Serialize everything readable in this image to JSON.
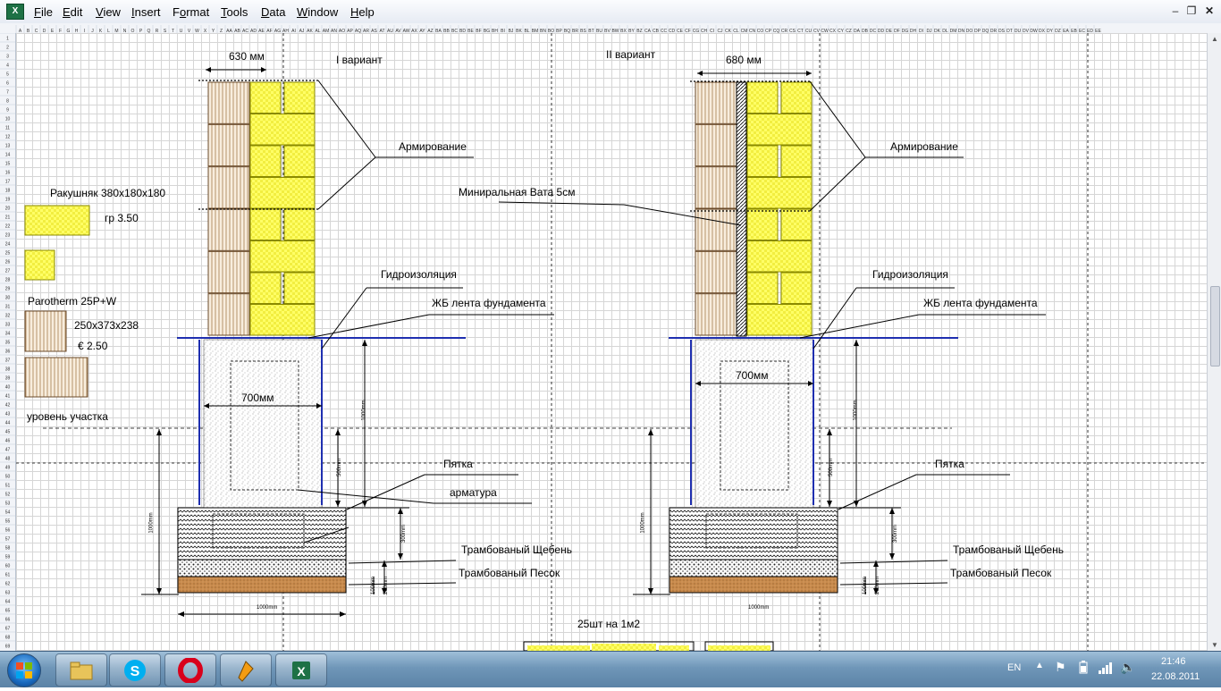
{
  "window": {
    "app_icon": "excel-icon",
    "menus": [
      {
        "label": "File",
        "accel": "F"
      },
      {
        "label": "Edit",
        "accel": "E"
      },
      {
        "label": "View",
        "accel": "V"
      },
      {
        "label": "Insert",
        "accel": "I"
      },
      {
        "label": "Format",
        "accel": "o"
      },
      {
        "label": "Tools",
        "accel": "T"
      },
      {
        "label": "Data",
        "accel": "D"
      },
      {
        "label": "Window",
        "accel": "W"
      },
      {
        "label": "Help",
        "accel": "H"
      }
    ],
    "controls": [
      "minimize-icon",
      "restore-icon",
      "close-icon"
    ]
  },
  "sheet": {
    "column_headers": [
      "A",
      "B",
      "C",
      "D",
      "E",
      "F",
      "G",
      "H",
      "I",
      "J",
      "K",
      "L",
      "M",
      "N",
      "O",
      "P",
      "Q",
      "R",
      "S",
      "T",
      "U",
      "V",
      "W",
      "X",
      "Y",
      "Z",
      "AA",
      "AB",
      "AC",
      "AD",
      "AE",
      "AF",
      "AG",
      "AH",
      "AI",
      "AJ",
      "AK",
      "AL",
      "AM",
      "AN",
      "AO",
      "AP",
      "AQ",
      "AR",
      "AS",
      "AT",
      "AU",
      "AV",
      "AW",
      "AX",
      "AY",
      "AZ",
      "BA",
      "BB",
      "BC",
      "BD",
      "BE",
      "BF",
      "BG",
      "BH",
      "BI",
      "BJ",
      "BK",
      "BL",
      "BM",
      "BN",
      "BO",
      "BP",
      "BQ",
      "BR",
      "BS",
      "BT",
      "BU",
      "BV",
      "BW",
      "BX",
      "BY",
      "BZ",
      "CA",
      "CB",
      "CC",
      "CD",
      "CE",
      "CF",
      "CG",
      "CH",
      "CI",
      "CJ",
      "CK",
      "CL",
      "CM",
      "CN",
      "CO",
      "CP",
      "CQ",
      "CR",
      "CS",
      "CT",
      "CU",
      "CV",
      "CW",
      "CX",
      "CY",
      "CZ",
      "DA",
      "DB",
      "DC",
      "DD",
      "DE",
      "DF",
      "DG",
      "DH",
      "DI",
      "DJ",
      "DK",
      "DL",
      "DM",
      "DN",
      "DO",
      "DP",
      "DQ",
      "DR",
      "DS",
      "DT",
      "DU",
      "DV",
      "DW",
      "DX",
      "DY",
      "DZ",
      "EA",
      "EB",
      "EC",
      "ED",
      "EE"
    ],
    "row_count": 69
  },
  "drawing": {
    "variant1": {
      "title": "I вариант",
      "width_label": "630 мм",
      "reinforcement": "Армирование",
      "waterproofing": "Гидроизоляция",
      "foundation": "ЖБ лента фундамента",
      "inner_width": "700мм",
      "heel": "Пятка",
      "rebar": "арматура",
      "gravel": "Трамбованый Щебень",
      "sand": "Трамбованый Песок",
      "bottom_width": "1000mm",
      "dim_1000a": "1000mm",
      "dim_500": "500mm",
      "dim_1000b": "1000mm",
      "dim_300": "300mm",
      "dim_100": "100mm",
      "dim_200": "200mm"
    },
    "variant2": {
      "title": "II вариант",
      "width_label": "680 мм",
      "reinforcement": "Армирование",
      "insulation": "Миниральная Вата 5см",
      "waterproofing": "Гидроизоляция",
      "foundation": "ЖБ лента фундамента",
      "inner_width": "700мм",
      "heel": "Пятка",
      "gravel": "Трамбованый Щебень",
      "sand": "Трамбованый Песок",
      "bottom_width": "1000mm",
      "dim_1000a": "1000mm",
      "dim_500": "500mm",
      "dim_1000b": "1000mm",
      "dim_300": "300mm",
      "dim_100": "100mm",
      "dim_200": "200mm"
    },
    "legend": {
      "rakushnyak": "Ракушняк 380x180x180",
      "rakushnyak_price": "гр 3.50",
      "parotherm": "Parotherm 25P+W",
      "parotherm_size": "250x373x238",
      "parotherm_price": "€ 2.50",
      "ground_level": "уровень участка"
    },
    "bottom_note": "25шт на 1м2"
  },
  "taskbar": {
    "start": "windows-start-icon",
    "apps": [
      "file-explorer-icon",
      "skype-icon",
      "opera-icon",
      "winamp-icon",
      "excel-icon"
    ],
    "language": "EN",
    "time": "21:46",
    "date": "22.08.2011",
    "tray_icons": [
      "show-hidden-icons-arrow",
      "flag-icon",
      "battery-icon",
      "network-signal-icon",
      "volume-icon"
    ]
  },
  "colors": {
    "yellow_block": "#ffff66",
    "block_edge": "#8a8a00",
    "parotherm_fill": "#f8eddd",
    "hydro_blue": "#1f2fb0",
    "sand_fill": "#c88a4c"
  }
}
